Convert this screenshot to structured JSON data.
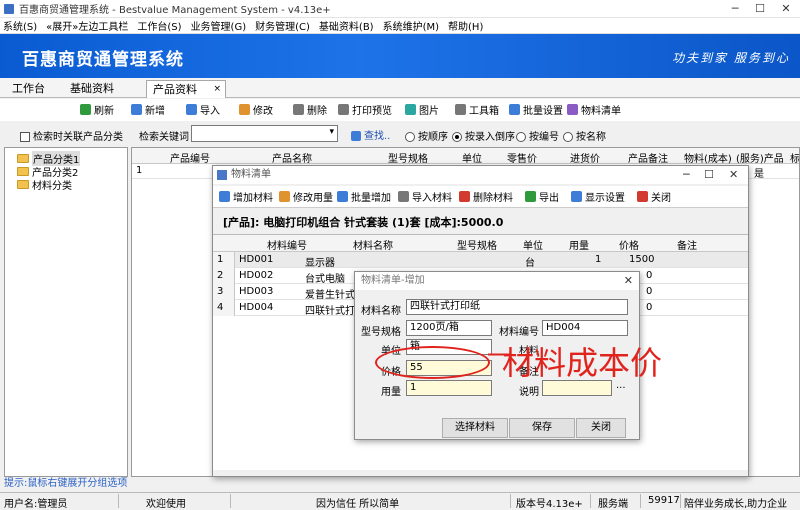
{
  "window": {
    "title": "百惠商贸通管理系统 - Bestvalue Management System - v4.13e+"
  },
  "menu": [
    "系统(S)",
    "«展开»左边工具栏",
    "工作台(S)",
    "业务管理(G)",
    "财务管理(C)",
    "基础资料(B)",
    "系统维护(M)",
    "帮助(H)"
  ],
  "banner": {
    "title": "百惠商贸通管理系统",
    "slogan": "功夫到家 服务到心"
  },
  "tabs": [
    {
      "label": "工作台"
    },
    {
      "label": "基础资料"
    },
    {
      "label": "产品资料"
    }
  ],
  "toolbar": [
    "刷新",
    "新增",
    "导入",
    "修改",
    "删除",
    "打印预览",
    "图片",
    "工具箱",
    "批量设置",
    "物料清单"
  ],
  "search": {
    "link_checkbox": "检索时关联产品分类",
    "keyword_label": "检索关键词",
    "keyword_value": "",
    "search_button": "查找..",
    "sort_options": [
      "按顺序",
      "按录入倒序",
      "按编号",
      "按名称"
    ],
    "sort_selected": 1
  },
  "tree": [
    "产品分类1",
    "产品分类2",
    "材料分类"
  ],
  "product_grid": {
    "columns": [
      "产品编号",
      "产品名称",
      "型号规格",
      "单位",
      "零售价",
      "进货价",
      "产品备注",
      "物料(成本)",
      "(服务)产品",
      "标"
    ],
    "row": {
      "num": "1",
      "service": "是"
    }
  },
  "material_dialog": {
    "title": "物料清单",
    "toolbar": [
      "增加材料",
      "修改用量",
      "批量增加",
      "导入材料",
      "删除材料",
      "导出",
      "显示设置",
      "关闭"
    ],
    "product_line": "[产品]:   电脑打印机组合  针式套装   (1)套   [成本]:5000.0",
    "columns": [
      "材料编号",
      "材料名称",
      "型号规格",
      "单位",
      "用量",
      "价格",
      "备注"
    ],
    "rows": [
      {
        "num": "1",
        "code": "HD001",
        "name": "显示器",
        "spec": "",
        "unit": "台",
        "qty": "1",
        "price": "1500"
      },
      {
        "num": "2",
        "code": "HD002",
        "name": "台式电脑",
        "spec": "",
        "unit": "",
        "qty": "",
        "price": "0"
      },
      {
        "num": "3",
        "code": "HD003",
        "name": "爱普生针式",
        "spec": "",
        "unit": "",
        "qty": "",
        "price": "0"
      },
      {
        "num": "4",
        "code": "HD004",
        "name": "四联针式打印",
        "spec": "",
        "unit": "",
        "qty": "",
        "price": "0"
      }
    ]
  },
  "add_dialog": {
    "title": "物料清单-增加",
    "material_name_label": "材料名称",
    "material_name": "四联针式打印纸",
    "spec_label": "型号规格",
    "spec": "1200页/箱",
    "code_label": "材料编号",
    "code": "HD004",
    "unit_label": "单位",
    "unit": "箱",
    "label_partial": "材料",
    "note_label": "备注",
    "price_label": "价格",
    "price": "55",
    "qty_label": "用量",
    "qty": "1",
    "desc_label": "说明",
    "desc": "",
    "ellipsis": "...",
    "buttons": {
      "select": "选择材料",
      "save": "保存",
      "close": "关闭"
    }
  },
  "annotation": "材料成本价",
  "tip": "提示:鼠标右键展开分组选项",
  "status": {
    "user": "用户名:管理员",
    "welcome": "欢迎使用",
    "motto": "因为信任 所以简单",
    "version": "版本号4.13e+",
    "server": "服务端",
    "code": "59917",
    "slogan": "陪伴业务成长,助力企业"
  },
  "colors": {
    "banner": "#1e73e8",
    "annotation": "#e0231c",
    "tip": "#2a62c8",
    "highlight_field": "#fffbd8"
  }
}
